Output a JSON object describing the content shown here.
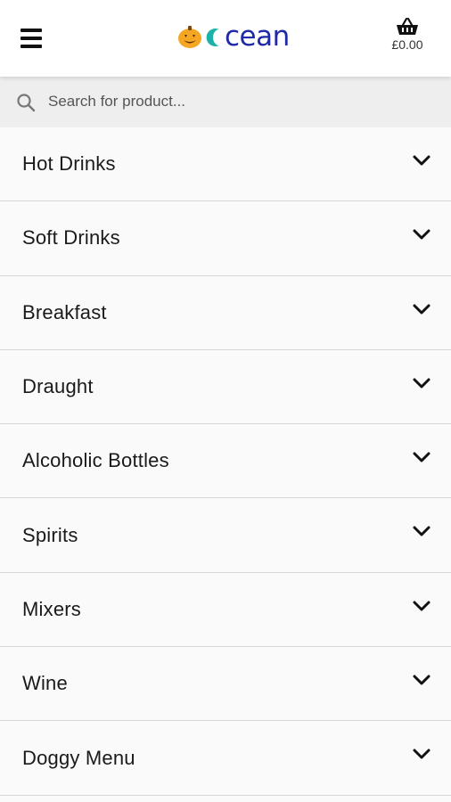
{
  "header": {
    "menu_icon": "hamburger-menu-icon",
    "logo_text": "cean",
    "logo_icon": "pumpkin-o-icon",
    "basket_icon": "basket-icon",
    "basket_total": "£0.00",
    "brand_color": "#1f2aa6",
    "pumpkin_color": "#f5a623",
    "accent_color": "#1bb3a8"
  },
  "search": {
    "icon": "search-icon",
    "placeholder": "Search for product..."
  },
  "categories": [
    {
      "label": "Hot Drinks",
      "icon": "chevron-down-icon"
    },
    {
      "label": "Soft Drinks",
      "icon": "chevron-down-icon"
    },
    {
      "label": "Breakfast",
      "icon": "chevron-down-icon"
    },
    {
      "label": "Draught",
      "icon": "chevron-down-icon"
    },
    {
      "label": "Alcoholic Bottles",
      "icon": "chevron-down-icon"
    },
    {
      "label": "Spirits",
      "icon": "chevron-down-icon"
    },
    {
      "label": "Mixers",
      "icon": "chevron-down-icon"
    },
    {
      "label": "Wine",
      "icon": "chevron-down-icon"
    },
    {
      "label": "Doggy Menu",
      "icon": "chevron-down-icon"
    }
  ]
}
